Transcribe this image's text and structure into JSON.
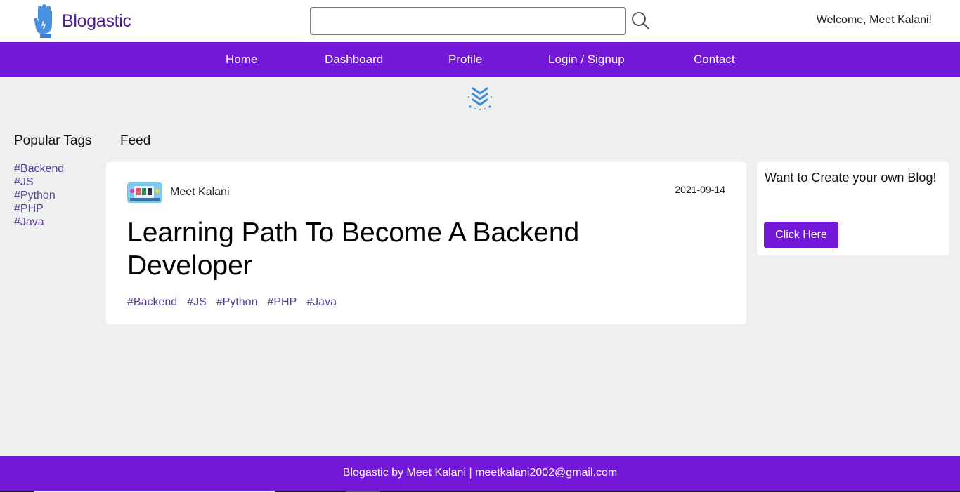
{
  "header": {
    "logo_text": "Blogastic",
    "search": {
      "value": "",
      "placeholder": ""
    },
    "welcome": "Welcome, Meet Kalani!"
  },
  "nav": {
    "items": [
      {
        "label": "Home"
      },
      {
        "label": "Dashboard"
      },
      {
        "label": "Profile"
      },
      {
        "label": "Login / Signup"
      },
      {
        "label": "Contact"
      }
    ]
  },
  "sidebar": {
    "title": "Popular Tags",
    "tags": [
      "#Backend",
      "#JS",
      "#Python",
      "#PHP",
      "#Java"
    ]
  },
  "feed": {
    "title": "Feed",
    "post": {
      "author": "Meet Kalani",
      "date": "2021-09-14",
      "title": "Learning Path To Become A Backend Developer",
      "tags": [
        "#Backend",
        "#JS",
        "#Python",
        "#PHP",
        "#Java"
      ]
    }
  },
  "promo": {
    "text": "Want to Create your own Blog!",
    "button_label": "Click Here"
  },
  "footer": {
    "prefix": "Blogastic by",
    "author_link": "Meet Kalani",
    "separator": "|",
    "email": "meetkalani2002@gmail.com"
  },
  "colors": {
    "primary": "#7317d9",
    "logo": "#4a1d96",
    "tag": "#5a3c9b",
    "background": "#eef0ef"
  },
  "icons": [
    "hand-logo-icon",
    "search-icon",
    "scroll-down-icon"
  ]
}
